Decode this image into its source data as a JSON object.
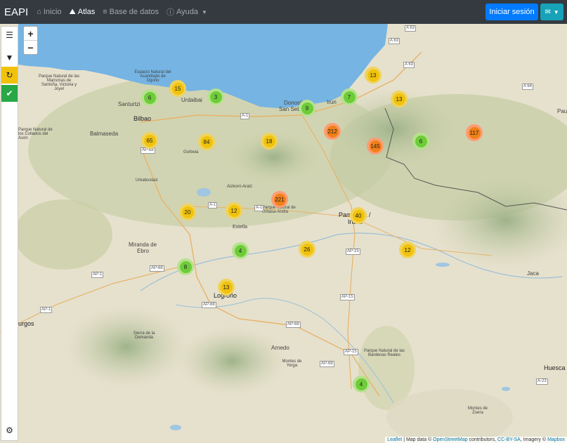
{
  "navbar": {
    "brand": "EAPI",
    "items": [
      {
        "icon": "⌂",
        "label": "Inicio"
      },
      {
        "icon": "⛰",
        "label": "Atlas"
      },
      {
        "icon": "≡",
        "label": "Base de datos"
      },
      {
        "icon": "ⓘ",
        "label": "Ayuda"
      }
    ],
    "login_label": "Iniciar sesión",
    "lang_icon": "✉"
  },
  "sidebar": {
    "menu_icon": "☰",
    "filter_icon": "▼",
    "refresh_icon": "↻",
    "check_icon": "✔",
    "settings_icon": "⚙"
  },
  "zoom": {
    "in": "+",
    "out": "−"
  },
  "clusters": [
    {
      "count": "6",
      "level": "green"
    },
    {
      "count": "15",
      "level": "yellow"
    },
    {
      "count": "3",
      "level": "green"
    },
    {
      "count": "9",
      "level": "green"
    },
    {
      "count": "7",
      "level": "green"
    },
    {
      "count": "13",
      "level": "yellow"
    },
    {
      "count": "13",
      "level": "yellow"
    },
    {
      "count": "65",
      "level": "yellow"
    },
    {
      "count": "84",
      "level": "yellow"
    },
    {
      "count": "18",
      "level": "yellow"
    },
    {
      "count": "212",
      "level": "orange"
    },
    {
      "count": "145",
      "level": "orange"
    },
    {
      "count": "6",
      "level": "green"
    },
    {
      "count": "117",
      "level": "orange"
    },
    {
      "count": "221",
      "level": "orange"
    },
    {
      "count": "20",
      "level": "yellow"
    },
    {
      "count": "12",
      "level": "yellow"
    },
    {
      "count": "40",
      "level": "yellow"
    },
    {
      "count": "4",
      "level": "green"
    },
    {
      "count": "26",
      "level": "yellow"
    },
    {
      "count": "12",
      "level": "yellow"
    },
    {
      "count": "8",
      "level": "green"
    },
    {
      "count": "13",
      "level": "yellow"
    },
    {
      "count": "4",
      "level": "green"
    }
  ],
  "colors": {
    "green_outer": "#b5e28c",
    "green_inner": "#6ecc39",
    "yellow_outer": "#f1d357",
    "yellow_inner": "#f0c20c",
    "orange_outer": "#fd9c73",
    "orange_inner": "#f18017",
    "sea": "#75b4e3"
  },
  "places": {
    "bilbao": "Bilbao",
    "santurtzi": "Santurtzi",
    "balmaseda": "Balmaseda",
    "donostia": "Donostia /",
    "san_sebastian": "San Sebastián",
    "irun": "Irun",
    "pamplona": "Pamplona /",
    "iruna": "Iruña",
    "miranda": "Miranda de",
    "ebro": "Ebro",
    "logrono": "Logroño",
    "burgos": "urgos",
    "arnedo": "Arnedo",
    "jaca": "Jaca",
    "huesca": "Huesca",
    "pau": "Pau",
    "urdaibai": "Urdaibai",
    "urbasa": "Parque natural de Urbasa-Andía",
    "aralar": "Aizkorri-Aratz",
    "estella": "Estella",
    "bardenas": "Parque Natural de las Bardenas Reales",
    "vitoria_park": "Parque Natural de las Marismas de Santoña, Victoria y Joyel",
    "collados": "Parque Natural de los Collados del Asón",
    "gorbeia": "Gorbeia",
    "urkiola": "Urkabustaiz",
    "opera": "Espacio Natural del Acantilado de Ogoño",
    "monte_yerga": "Montes de Yerga",
    "montes_zuera": "Montes de Zuera",
    "sierra": "Sierra de la Demanda"
  },
  "roads": {
    "a1_a": "A-1",
    "a1_b": "A-1",
    "a1_c": "A-1",
    "a63_a": "A 63",
    "a63_b": "A 63",
    "a63_c": "A 63",
    "a64": "A 64",
    "ap68_a": "AP-68",
    "ap68_b": "AP-68",
    "ap68_c": "AP-68",
    "ap68_d": "AP-68",
    "ap68_e": "AP-68",
    "ap15_a": "AP-15",
    "ap15_b": "AP-15",
    "ap15_c": "AP-15",
    "ap1_a": "AP-1",
    "ap1_b": "AP-1",
    "a23": "A-23"
  },
  "attribution": {
    "leaflet": "Leaflet",
    "text1": " | Map data © ",
    "osm": "OpenStreetMap",
    "text2": " contributors, ",
    "cc": "CC-BY-SA",
    "text3": ", Imagery © ",
    "mapbox": "Mapbox"
  }
}
